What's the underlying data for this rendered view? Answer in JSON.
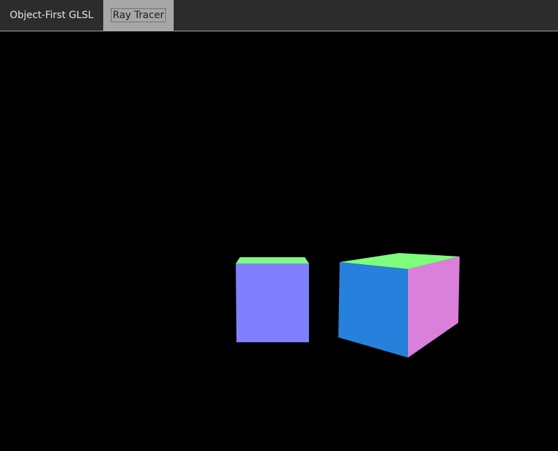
{
  "tabs": [
    {
      "label": "Object-First GLSL",
      "selected": false
    },
    {
      "label": "Ray Tracer",
      "selected": true
    }
  ],
  "colors": {
    "tabbar_background": "#2c2c2c",
    "selected_tab_background": "#a7a7a7",
    "viewport_background": "#000000",
    "face_top": "#7dfe7d",
    "face_front_left_cube": "#8080fe",
    "face_front_right_cube": "#2680dc",
    "face_side_right_cube": "#da80da"
  },
  "scene": {
    "objects": [
      {
        "name": "cube",
        "visible_faces": [
          "top",
          "front"
        ]
      },
      {
        "name": "cube",
        "visible_faces": [
          "top",
          "front",
          "right"
        ]
      }
    ]
  }
}
